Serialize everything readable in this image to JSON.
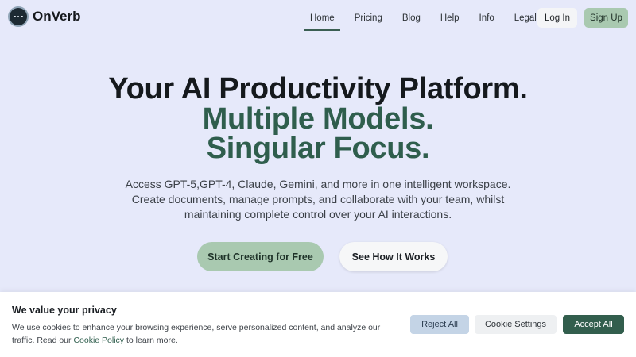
{
  "brand": {
    "name": "OnVerb",
    "logo_icon": "chat-dots-icon"
  },
  "nav": {
    "items": [
      {
        "label": "Home",
        "active": true
      },
      {
        "label": "Pricing",
        "active": false
      },
      {
        "label": "Blog",
        "active": false
      },
      {
        "label": "Help",
        "active": false
      },
      {
        "label": "Info",
        "active": false
      },
      {
        "label": "Legal",
        "active": false
      }
    ],
    "login_label": "Log In",
    "signup_label": "Sign Up"
  },
  "hero": {
    "headline_1": "Your AI Productivity Platform.",
    "headline_2": "Multiple Models.",
    "headline_3": "Singular Focus.",
    "subtitle_lines": [
      "Access GPT-5,GPT-4, Claude, Gemini, and more in one intelligent workspace.",
      "Create documents, manage prompts, and collaborate with your team, whilst",
      "maintaining complete control over your AI interactions."
    ],
    "cta_primary": "Start Creating for Free",
    "cta_secondary": "See How It Works"
  },
  "cookie_banner": {
    "title": "We value your privacy",
    "text_before_link": "We use cookies to enhance your browsing experience, serve personalized content, and analyze our traffic. Read our ",
    "link_text": "Cookie Policy",
    "text_after_link": " to learn more.",
    "reject_label": "Reject All",
    "settings_label": "Cookie Settings",
    "accept_label": "Accept All"
  },
  "colors": {
    "page_bg": "#e6e9fa",
    "accent_green": "#2f5e4d",
    "soft_green": "#a9c9b0",
    "reject_blue": "#c4d4e6"
  }
}
